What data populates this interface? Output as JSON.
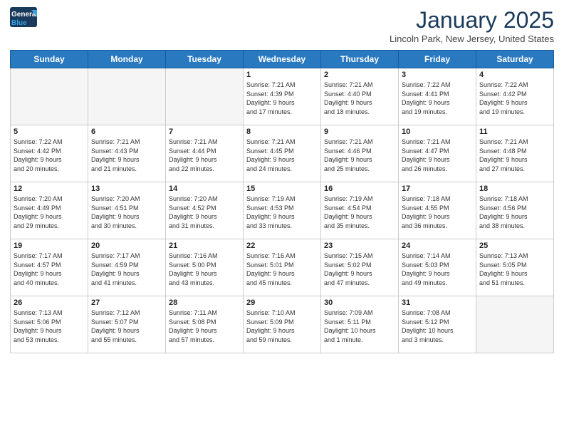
{
  "header": {
    "logo_line1": "General",
    "logo_line2": "Blue",
    "title": "January 2025",
    "subtitle": "Lincoln Park, New Jersey, United States"
  },
  "days_of_week": [
    "Sunday",
    "Monday",
    "Tuesday",
    "Wednesday",
    "Thursday",
    "Friday",
    "Saturday"
  ],
  "weeks": [
    [
      {
        "day": "",
        "info": ""
      },
      {
        "day": "",
        "info": ""
      },
      {
        "day": "",
        "info": ""
      },
      {
        "day": "1",
        "info": "Sunrise: 7:21 AM\nSunset: 4:39 PM\nDaylight: 9 hours\nand 17 minutes."
      },
      {
        "day": "2",
        "info": "Sunrise: 7:21 AM\nSunset: 4:40 PM\nDaylight: 9 hours\nand 18 minutes."
      },
      {
        "day": "3",
        "info": "Sunrise: 7:22 AM\nSunset: 4:41 PM\nDaylight: 9 hours\nand 19 minutes."
      },
      {
        "day": "4",
        "info": "Sunrise: 7:22 AM\nSunset: 4:42 PM\nDaylight: 9 hours\nand 19 minutes."
      }
    ],
    [
      {
        "day": "5",
        "info": "Sunrise: 7:22 AM\nSunset: 4:42 PM\nDaylight: 9 hours\nand 20 minutes."
      },
      {
        "day": "6",
        "info": "Sunrise: 7:21 AM\nSunset: 4:43 PM\nDaylight: 9 hours\nand 21 minutes."
      },
      {
        "day": "7",
        "info": "Sunrise: 7:21 AM\nSunset: 4:44 PM\nDaylight: 9 hours\nand 22 minutes."
      },
      {
        "day": "8",
        "info": "Sunrise: 7:21 AM\nSunset: 4:45 PM\nDaylight: 9 hours\nand 24 minutes."
      },
      {
        "day": "9",
        "info": "Sunrise: 7:21 AM\nSunset: 4:46 PM\nDaylight: 9 hours\nand 25 minutes."
      },
      {
        "day": "10",
        "info": "Sunrise: 7:21 AM\nSunset: 4:47 PM\nDaylight: 9 hours\nand 26 minutes."
      },
      {
        "day": "11",
        "info": "Sunrise: 7:21 AM\nSunset: 4:48 PM\nDaylight: 9 hours\nand 27 minutes."
      }
    ],
    [
      {
        "day": "12",
        "info": "Sunrise: 7:20 AM\nSunset: 4:49 PM\nDaylight: 9 hours\nand 29 minutes."
      },
      {
        "day": "13",
        "info": "Sunrise: 7:20 AM\nSunset: 4:51 PM\nDaylight: 9 hours\nand 30 minutes."
      },
      {
        "day": "14",
        "info": "Sunrise: 7:20 AM\nSunset: 4:52 PM\nDaylight: 9 hours\nand 31 minutes."
      },
      {
        "day": "15",
        "info": "Sunrise: 7:19 AM\nSunset: 4:53 PM\nDaylight: 9 hours\nand 33 minutes."
      },
      {
        "day": "16",
        "info": "Sunrise: 7:19 AM\nSunset: 4:54 PM\nDaylight: 9 hours\nand 35 minutes."
      },
      {
        "day": "17",
        "info": "Sunrise: 7:18 AM\nSunset: 4:55 PM\nDaylight: 9 hours\nand 36 minutes."
      },
      {
        "day": "18",
        "info": "Sunrise: 7:18 AM\nSunset: 4:56 PM\nDaylight: 9 hours\nand 38 minutes."
      }
    ],
    [
      {
        "day": "19",
        "info": "Sunrise: 7:17 AM\nSunset: 4:57 PM\nDaylight: 9 hours\nand 40 minutes."
      },
      {
        "day": "20",
        "info": "Sunrise: 7:17 AM\nSunset: 4:59 PM\nDaylight: 9 hours\nand 41 minutes."
      },
      {
        "day": "21",
        "info": "Sunrise: 7:16 AM\nSunset: 5:00 PM\nDaylight: 9 hours\nand 43 minutes."
      },
      {
        "day": "22",
        "info": "Sunrise: 7:16 AM\nSunset: 5:01 PM\nDaylight: 9 hours\nand 45 minutes."
      },
      {
        "day": "23",
        "info": "Sunrise: 7:15 AM\nSunset: 5:02 PM\nDaylight: 9 hours\nand 47 minutes."
      },
      {
        "day": "24",
        "info": "Sunrise: 7:14 AM\nSunset: 5:03 PM\nDaylight: 9 hours\nand 49 minutes."
      },
      {
        "day": "25",
        "info": "Sunrise: 7:13 AM\nSunset: 5:05 PM\nDaylight: 9 hours\nand 51 minutes."
      }
    ],
    [
      {
        "day": "26",
        "info": "Sunrise: 7:13 AM\nSunset: 5:06 PM\nDaylight: 9 hours\nand 53 minutes."
      },
      {
        "day": "27",
        "info": "Sunrise: 7:12 AM\nSunset: 5:07 PM\nDaylight: 9 hours\nand 55 minutes."
      },
      {
        "day": "28",
        "info": "Sunrise: 7:11 AM\nSunset: 5:08 PM\nDaylight: 9 hours\nand 57 minutes."
      },
      {
        "day": "29",
        "info": "Sunrise: 7:10 AM\nSunset: 5:09 PM\nDaylight: 9 hours\nand 59 minutes."
      },
      {
        "day": "30",
        "info": "Sunrise: 7:09 AM\nSunset: 5:11 PM\nDaylight: 10 hours\nand 1 minute."
      },
      {
        "day": "31",
        "info": "Sunrise: 7:08 AM\nSunset: 5:12 PM\nDaylight: 10 hours\nand 3 minutes."
      },
      {
        "day": "",
        "info": ""
      }
    ]
  ]
}
